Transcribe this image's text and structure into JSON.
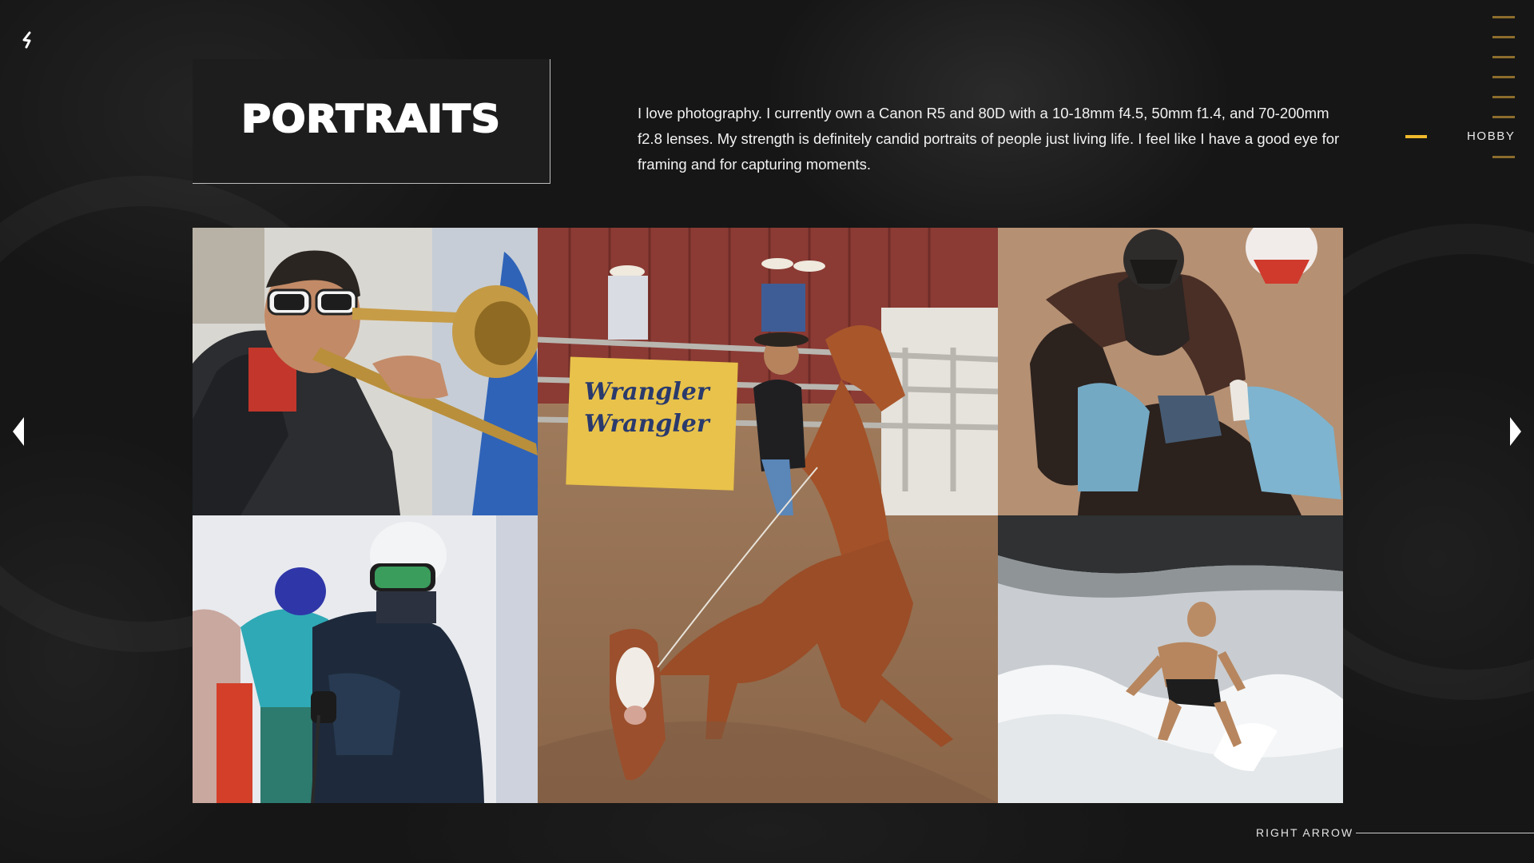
{
  "page": {
    "title": "PORTRAITS",
    "description": "I love photography. I currently own a Canon R5 and 80D with a 10-18mm f4.5, 50mm f1.4, and 70-200mm f2.8 lenses. My strength is definitely candid portraits of people just living life. I feel like I have a good eye for framing and for capturing moments."
  },
  "nav": {
    "back_icon": "back-arrow-icon",
    "active_label": "HOBBY",
    "accent_color": "#f0b92d",
    "line_color": "#8c6d2c"
  },
  "gallery": {
    "prev_icon": "triangle-left-icon",
    "next_icon": "triangle-right-icon",
    "photos": [
      {
        "subject": "trombone player"
      },
      {
        "subject": "rodeo calf roping"
      },
      {
        "subject": "bull rider"
      },
      {
        "subject": "young skier"
      },
      {
        "subject": "surfer"
      }
    ],
    "rodeo_banner_text_1": "Wrangler",
    "rodeo_banner_text_2": "Wrangler"
  },
  "footer": {
    "right_arrow_label": "RIGHT ARROW"
  }
}
